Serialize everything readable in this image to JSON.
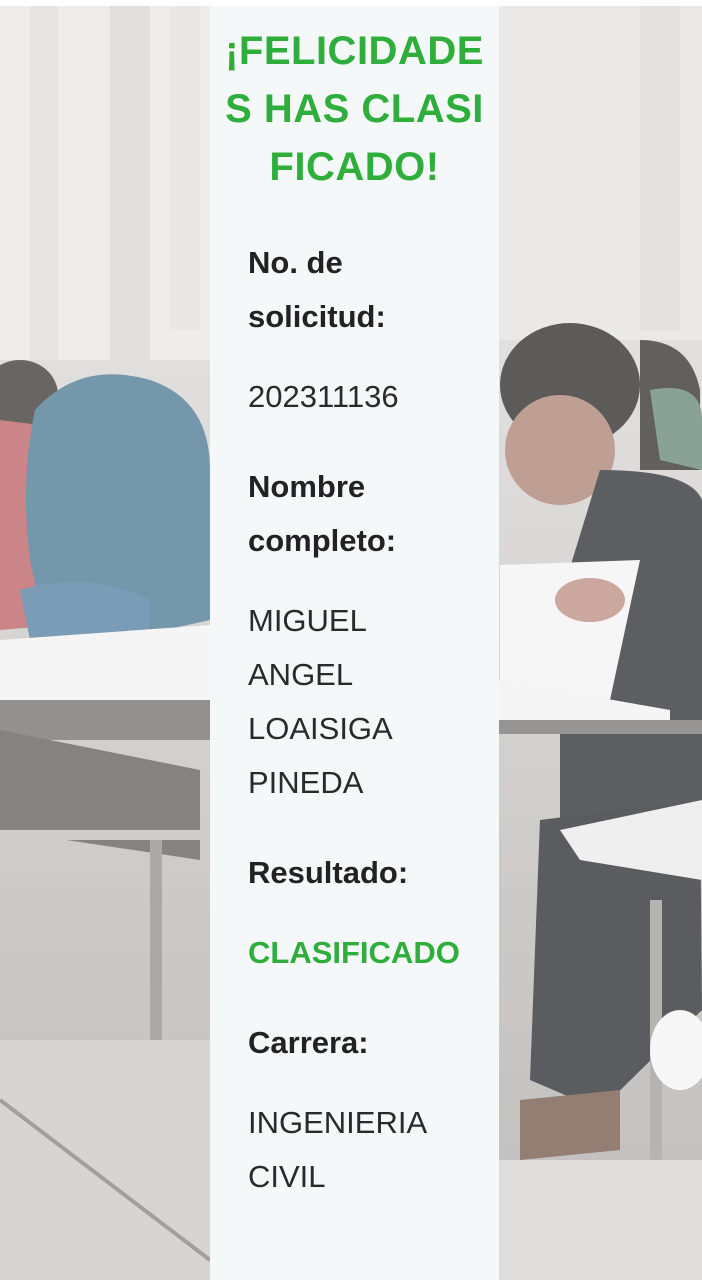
{
  "headline": "¡FELICIDADES HAS CLASIFICADO!",
  "fields": [
    {
      "label": "No. de solicitud:",
      "value": "202311136"
    },
    {
      "label": "Nombre completo:",
      "value": "MIGUEL ANGEL LOAISIGA PINEDA"
    },
    {
      "label": "Resultado:",
      "value": "CLASIFICADO"
    },
    {
      "label": "Carrera:",
      "value": "INGENIERIA CIVIL"
    }
  ],
  "colors": {
    "accent": "#2fae3c",
    "card_background": "#f5f8f9",
    "text": "#222222"
  }
}
